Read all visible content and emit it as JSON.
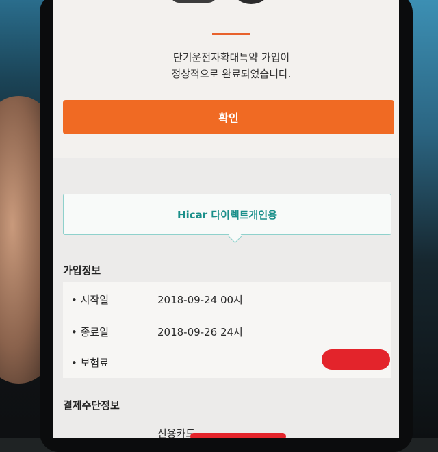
{
  "confirmation": {
    "message_line1": "단기운전자확대특약 가입이",
    "message_line2": "정상적으로 완료되었습니다.",
    "confirm_label": "확인"
  },
  "product": {
    "name": "Hicar 다이렉트개인용"
  },
  "subscription_info": {
    "title": "가입정보",
    "rows": [
      {
        "label": "• 시작일",
        "value": "2018-09-24 00시"
      },
      {
        "label": "• 종료일",
        "value": "2018-09-26 24시"
      },
      {
        "label": "• 보험료",
        "value": ""
      }
    ]
  },
  "payment_info": {
    "title": "결제수단정보",
    "method_value": "신용카드"
  },
  "colors": {
    "accent": "#f06a23",
    "teal": "#1a8f8a",
    "redaction": "#e3242b"
  }
}
